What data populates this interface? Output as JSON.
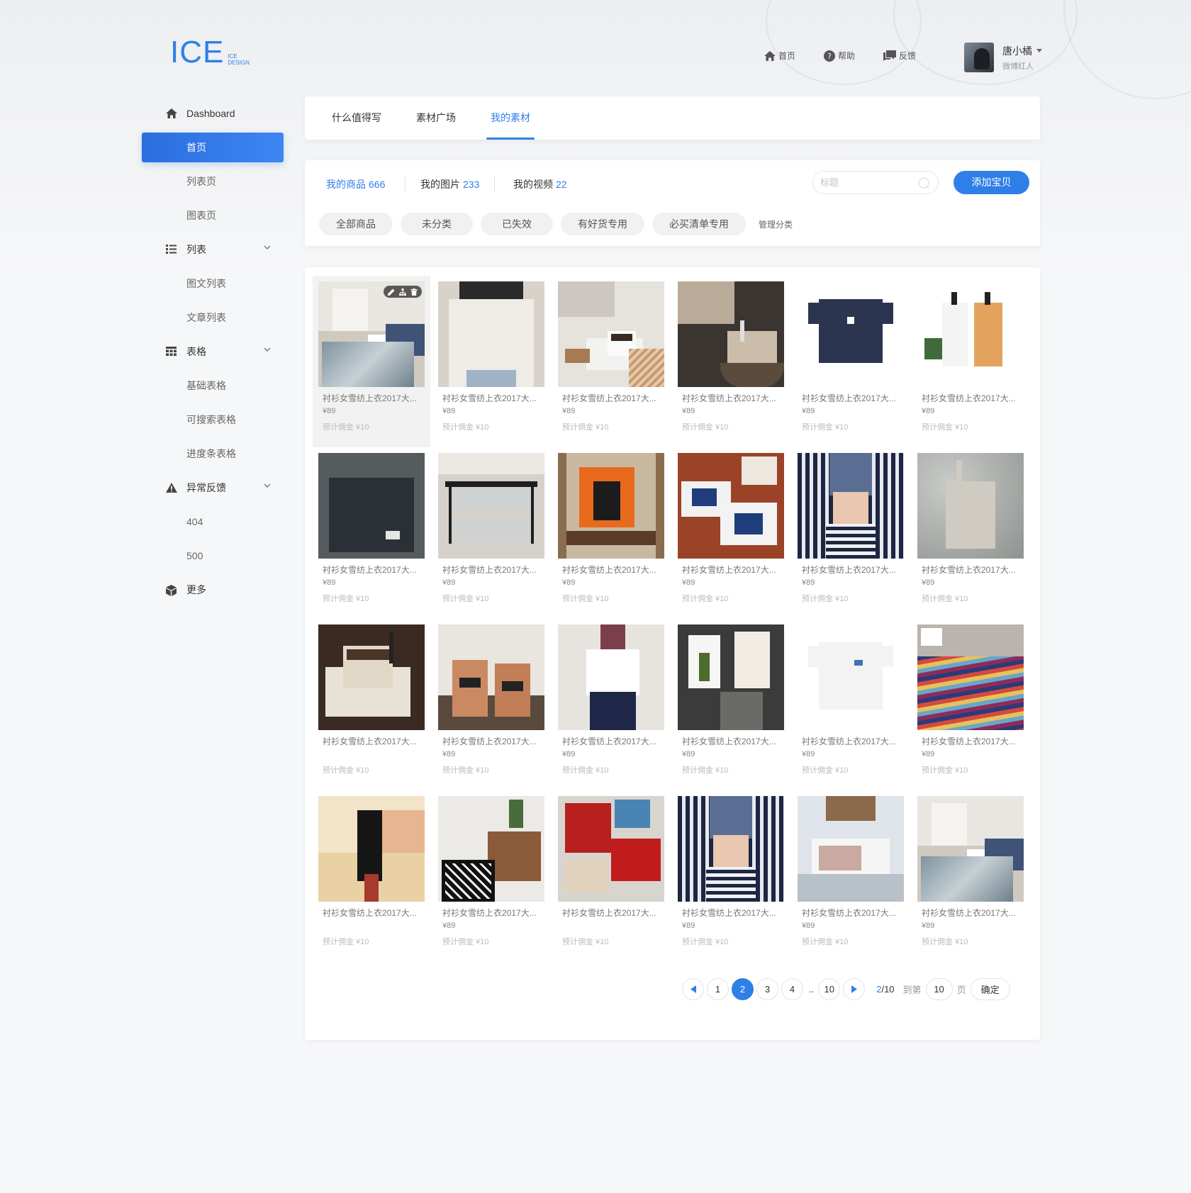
{
  "logo": {
    "mark": "ICE",
    "sub_line1": "ICE",
    "sub_line2": "DESIGN"
  },
  "topnav": [
    {
      "label": "首页",
      "icon": "home-icon"
    },
    {
      "label": "帮助",
      "icon": "help-icon"
    },
    {
      "label": "反馈",
      "icon": "feedback-icon"
    }
  ],
  "user": {
    "name": "唐小橘",
    "role": "微博红人"
  },
  "sidebar": {
    "dashboard": "Dashboard",
    "home": "首页",
    "list_page": "列表页",
    "chart_page": "图表页",
    "list": "列表",
    "list_subs": [
      "图文列表",
      "文章列表"
    ],
    "table": "表格",
    "table_subs": [
      "基础表格",
      "可搜索表格",
      "进度条表格"
    ],
    "error": "异常反馈",
    "error_subs": [
      "404",
      "500"
    ],
    "more": "更多"
  },
  "tabs": [
    "什么值得写",
    "素材广场",
    "我的素材"
  ],
  "active_tab": "我的素材",
  "stats": [
    {
      "label": "我的商品",
      "count": "666"
    },
    {
      "label": "我的图片",
      "count": "233"
    },
    {
      "label": "我的视频",
      "count": "22"
    }
  ],
  "search": {
    "placeholder": "标题"
  },
  "add_button": "添加宝贝",
  "categories": [
    "全部商品",
    "未分类",
    "已失效",
    "有好货专用",
    "必买清单专用"
  ],
  "manage_label": "管理分类",
  "product_title": "衬衫女雪纺上衣2017大...",
  "product_price": "¥89",
  "product_commission": "预计佣金 ¥10",
  "products": [
    {
      "scene": "living-room",
      "price": true,
      "hover": true
    },
    {
      "scene": "tshirt-woman",
      "price": true
    },
    {
      "scene": "coffee-book",
      "price": true
    },
    {
      "scene": "teapot-pour",
      "price": true
    },
    {
      "scene": "navy-tshirt",
      "price": true
    },
    {
      "scene": "soap-bottles",
      "price": true
    },
    {
      "scene": "black-bag",
      "price": true
    },
    {
      "scene": "glass-rack",
      "price": true
    },
    {
      "scene": "horse-painting",
      "price": true
    },
    {
      "scene": "blue-teacups",
      "price": true
    },
    {
      "scene": "striped-rug-feet",
      "price": true
    },
    {
      "scene": "grey-bag",
      "price": true
    },
    {
      "scene": "coffee-cup",
      "price": false
    },
    {
      "scene": "copper-cups",
      "price": true
    },
    {
      "scene": "white-tee-skirt",
      "price": true
    },
    {
      "scene": "pineapple-frames",
      "price": true
    },
    {
      "scene": "white-tshirt",
      "price": true
    },
    {
      "scene": "colorful-rug",
      "price": true
    },
    {
      "scene": "wine-opener",
      "price": false
    },
    {
      "scene": "wood-dresser",
      "price": true
    },
    {
      "scene": "red-teapot",
      "price": false
    },
    {
      "scene": "striped-rug-feet",
      "price": true
    },
    {
      "scene": "chandelier-bed",
      "price": true
    },
    {
      "scene": "living-room",
      "price": true
    }
  ],
  "pagination": {
    "pages": [
      "1",
      "2",
      "3",
      "4"
    ],
    "active": "2",
    "dots": "..",
    "last": "10",
    "current": "2",
    "total": "/10",
    "goto_label": "到第",
    "goto_value": "10",
    "unit": "页",
    "confirm": "确定"
  },
  "colors": {
    "accent": "#2f7fe8"
  }
}
